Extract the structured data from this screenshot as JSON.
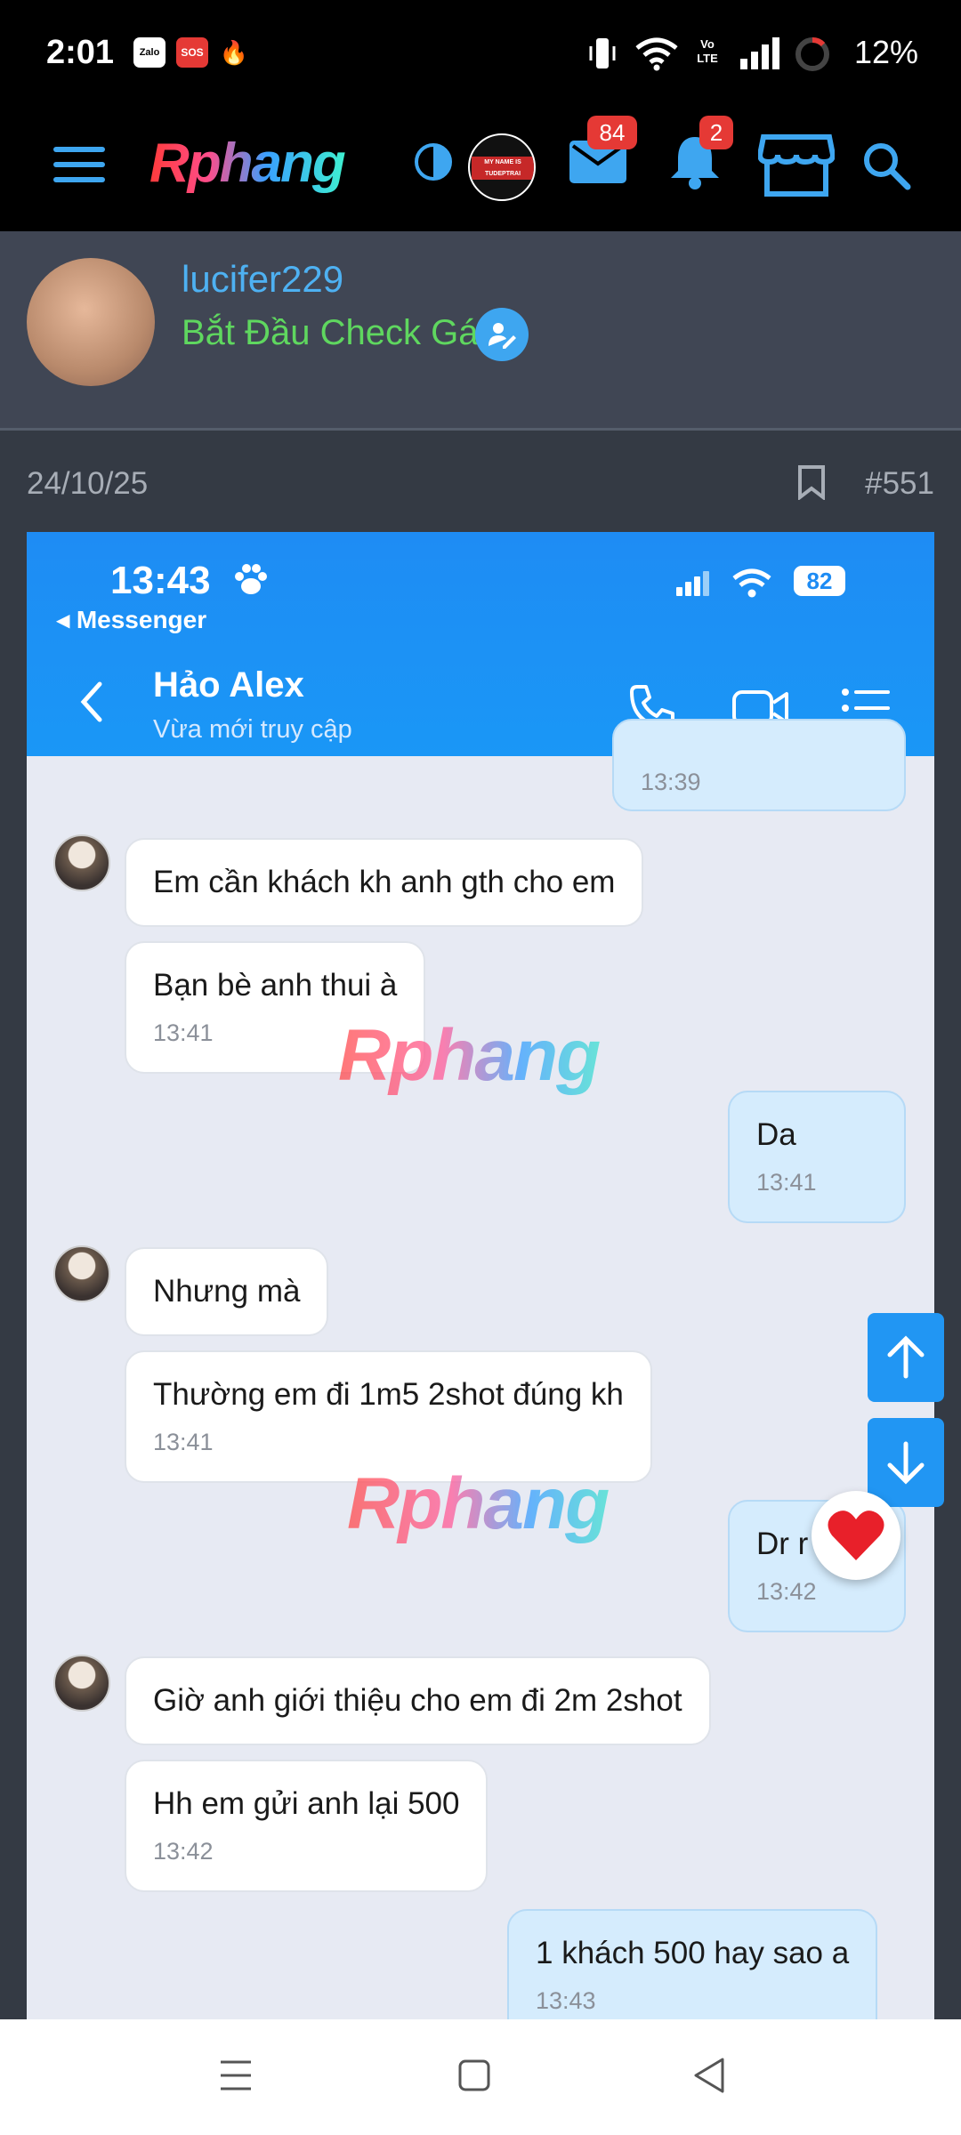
{
  "status": {
    "time": "2:01",
    "zalo": "Zalo",
    "sos": "SOS",
    "volte": "Vo LTE",
    "battery": "12%"
  },
  "nav": {
    "logo": "Rphang",
    "user_badge": "MY NAME IS TUDEPTRAI",
    "messages_count": "84",
    "alerts_count": "2"
  },
  "profile": {
    "username": "lucifer229",
    "title": "Bắt Đầu Check Gái"
  },
  "post": {
    "date": "24/10/25",
    "number": "#551"
  },
  "shot": {
    "time": "13:43",
    "back_app": "◂ Messenger",
    "battery": "82",
    "contact_name": "Hảo Alex",
    "contact_status": "Vừa mới truy cập",
    "watermark": "Rphang",
    "messages": [
      {
        "text": "",
        "time": "13:39"
      },
      {
        "text": "Em cần khách kh anh gth cho em",
        "time": ""
      },
      {
        "text": "Bạn bè anh thui à",
        "time": "13:41"
      },
      {
        "text": "Da",
        "time": "13:41"
      },
      {
        "text": "Nhưng mà",
        "time": ""
      },
      {
        "text": "Thường em đi 1m5 2shot đúng kh",
        "time": "13:41"
      },
      {
        "text": "Dr r",
        "time": "13:42"
      },
      {
        "text": "Giờ anh giới thiệu cho em đi 2m 2shot",
        "time": ""
      },
      {
        "text": "Hh em gửi anh lại 500",
        "time": "13:42"
      },
      {
        "text": "1 khách 500 hay sao a",
        "time": "13:43"
      }
    ]
  },
  "colors": {
    "accent": "#2196f3",
    "username": "#4eb1f2",
    "title": "#5fd75f",
    "zalo_blue": "#1e8cf4"
  }
}
